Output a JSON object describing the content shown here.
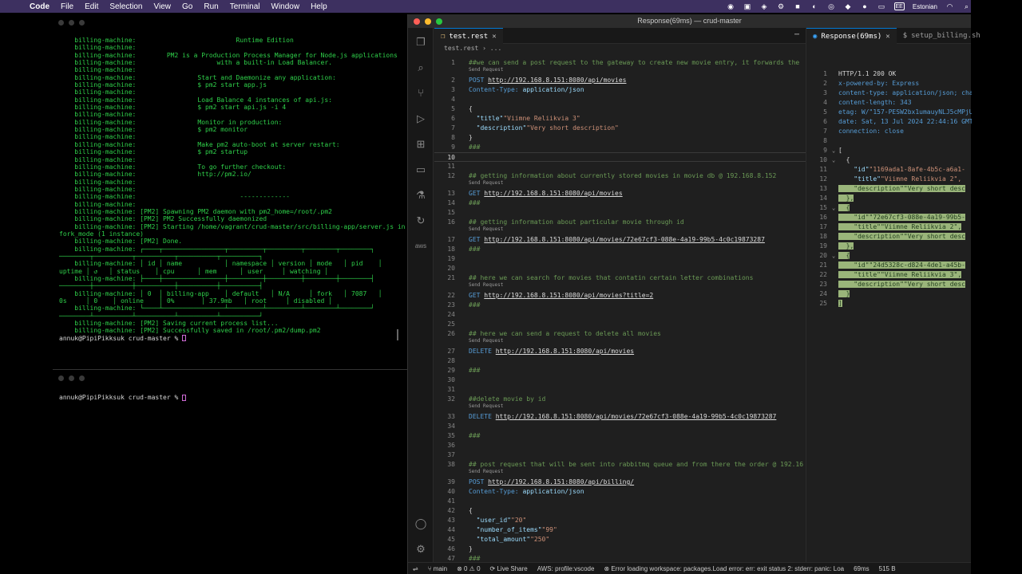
{
  "menubar": {
    "app": "Code",
    "items": [
      "File",
      "Edit",
      "Selection",
      "View",
      "Go",
      "Run",
      "Terminal",
      "Window",
      "Help"
    ],
    "input_source": "EE",
    "language": "Estonian"
  },
  "terminal": {
    "pane1_lines": [
      "    billing-machine:                          Runtime Edition",
      "    billing-machine:",
      "    billing-machine:        PM2 is a Production Process Manager for Node.js applications",
      "    billing-machine:                     with a built-in Load Balancer.",
      "    billing-machine:",
      "    billing-machine:                Start and Daemonize any application:",
      "    billing-machine:                $ pm2 start app.js",
      "    billing-machine:",
      "    billing-machine:                Load Balance 4 instances of api.js:",
      "    billing-machine:                $ pm2 start api.js -i 4",
      "    billing-machine:",
      "    billing-machine:                Monitor in production:",
      "    billing-machine:                $ pm2 monitor",
      "    billing-machine:",
      "    billing-machine:                Make pm2 auto-boot at server restart:",
      "    billing-machine:                $ pm2 startup",
      "    billing-machine:",
      "    billing-machine:                To go further checkout:",
      "    billing-machine:                http://pm2.io/",
      "    billing-machine:",
      "    billing-machine:",
      "    billing-machine:                           -------------",
      "    billing-machine:",
      "    billing-machine: [PM2] Spawning PM2 daemon with pm2_home=/root/.pm2",
      "    billing-machine: [PM2] PM2 Successfully daemonized",
      "    billing-machine: [PM2] Starting /home/vagrant/crud-master/src/billing-app/server.js in",
      "fork_mode (1 instance)",
      "    billing-machine: [PM2] Done.",
      "    billing-machine: ┌────┬────────────────┬─────────┬─────────┬────────┬────────┐",
      "────────┬──────────┬──────────┬──────────┬──────────┐",
      "    billing-machine: │ id │ name           │ namespace │ version │ mode   │ pid    │",
      "uptime │ ↺   │ status    │ cpu      │ mem      │ user     │ watching │",
      "    billing-machine: ├────┼────────────────┼─────────┼─────────┼────────┼────────┤",
      "────────┼──────────┼──────────┼──────────┼──────────┤",
      "    billing-machine: │ 0  │ billing-app    │ default   │ N/A     │ fork   │ 7087   │",
      "0s     │ 0    │ online    │ 0%       │ 37.9mb   │ root     │ disabled │",
      "    billing-machine: └────┴────────────────┴─────────┴─────────┴────────┴────────┘",
      "────────┴──────────┴──────────┴──────────┴──────────┘",
      "    billing-machine: [PM2] Saving current process list...",
      "    billing-machine: [PM2] Successfully saved in /root/.pm2/dump.pm2"
    ],
    "prompt1": "annuk@PipiPikksuk crud-master % ",
    "prompt2": "annuk@PipiPikksuk crud-master % "
  },
  "vscode": {
    "window_title": "Response(69ms) — crud-master",
    "editor_tab": "test.rest",
    "breadcrumb": "test.rest",
    "response_tab": "Response(69ms)",
    "other_tab": "setup_billing.sh",
    "send_request": "Send Request",
    "code": {
      "l1": "##we can send a post request to the gateway to create new movie entry, it forwards the",
      "l2_method": "POST",
      "l2_url": "http://192.168.8.151:8080/api/movies",
      "l3_key": "Content-Type:",
      "l3_val": " application/json",
      "l5": "{",
      "l6_key": "\"title\"",
      "l6_val": "\"Viimne Reliikvia 3\"",
      "l7_key": "\"description\"",
      "l7_val": "\"Very short description\"",
      "l8": "}",
      "l9": "###",
      "l12": "## getting information about currently stored movies in movie db @ 192.168.8.152",
      "l13_method": "GET",
      "l13_url": "http://192.168.8.151:8080/api/movies",
      "l14": "###",
      "l16": "## getting information about particular movie through id",
      "l17_method": "GET",
      "l17_url": "http://192.168.8.151:8080/api/movies/72e67cf3-088e-4a19-99b5-4c0c19873287",
      "l18": "###",
      "l21": "## here we can search for movies that contatin certain letter combinations",
      "l22_method": "GET",
      "l22_url": "http://192.168.8.151:8080/api/movies?title=2",
      "l23": "###",
      "l26": "## here we can send a request to delete all movies",
      "l27_method": "DELETE",
      "l27_url": "http://192.168.8.151:8080/api/movies",
      "l29": "###",
      "l32": "##delete movie by id",
      "l33_method": "DELETE",
      "l33_url": "http://192.168.8.151:8080/api/movies/72e67cf3-088e-4a19-99b5-4c0c19873287",
      "l35": "###",
      "l38": "## post request that will be sent into rabbitmq queue and from there the order @ 192.16",
      "l39_method": "POST",
      "l39_url": "http://192.168.8.151:8080/api/billing/",
      "l40_key": "Content-Type:",
      "l40_val": " application/json",
      "l42": "{",
      "l43_key": "\"user_id\"",
      "l43_val": "\"20\"",
      "l44_key": "\"number_of_items\"",
      "l44_val": "\"99\"",
      "l45_key": "\"total_amount\"",
      "l45_val": "\"250\"",
      "l46": "}",
      "l47": "###"
    },
    "response": {
      "r1": "HTTP/1.1 200 OK",
      "r2": "x-powered-by: Express",
      "r3": "content-type: application/json; cha",
      "r4": "content-length: 343",
      "r5": "etag: W/\"157-PESW2bx1umauyNLJ5cMPjU",
      "r6": "date: Sat, 13 Jul 2024 22:44:16 GMT",
      "r7": "connection: close",
      "r9": "[",
      "r10": "{",
      "r11_key": "\"id\"",
      "r11_val": "\"1169ada1-8afe-4b5c-a6a1-",
      "r12_key": "\"title\"",
      "r12_val": "\"Viimne Reliikvia 2\",",
      "r13_key": "\"description\"",
      "r13_val": "\"Very short desc",
      "r14": "},",
      "r15": "{",
      "r16_key": "\"id\"",
      "r16_val": "\"72e67cf3-088e-4a19-99b5-",
      "r17_key": "\"title\"",
      "r17_val": "\"Viimne Reliikvia 2\",",
      "r18_key": "\"description\"",
      "r18_val": "\"Very short desc",
      "r19": "},",
      "r20": "{",
      "r21_key": "\"id\"",
      "r21_val": "\"24d5328c-d824-4de1-a45b-",
      "r22_key": "\"title\"",
      "r22_val": "\"Viimne Reliikvia 3\",",
      "r23_key": "\"description\"",
      "r23_val": "\"Very short desc",
      "r24": "}",
      "r25": "]"
    },
    "status": {
      "branch": "main",
      "problems": "⊗ 0 ⚠ 0",
      "liveshare": "Live Share",
      "aws": "AWS: profile:vscode",
      "error": "Error loading workspace: packages.Load error: err: exit status 2: stderr: panic: Loa",
      "time": "69ms",
      "size": "515 B"
    }
  }
}
